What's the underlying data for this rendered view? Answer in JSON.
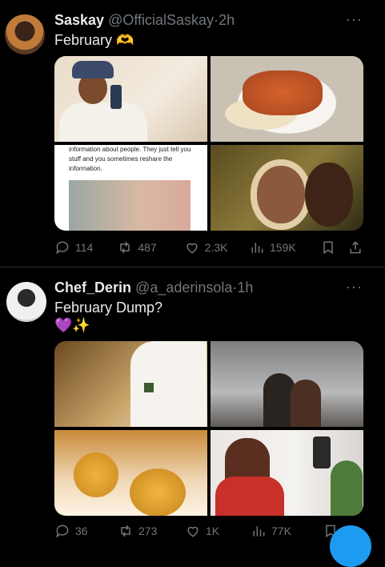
{
  "tweets": [
    {
      "name": "Saskay",
      "handle": "@OfficialSaskay",
      "time": "2h",
      "text": "February 🫶",
      "card_text": "information about people. They just tell you stuff and you sometimes reshare the information.",
      "stats": {
        "replies": "114",
        "retweets": "487",
        "likes": "2.3K",
        "views": "159K"
      }
    },
    {
      "name": "Chef_Derin",
      "handle": "@a_aderinsola",
      "time": "1h",
      "text": "February Dump?",
      "emoji_line": "💜✨",
      "stats": {
        "replies": "36",
        "retweets": "273",
        "likes": "1K",
        "views": "77K"
      }
    }
  ],
  "ui": {
    "more": "···",
    "dot": "·"
  },
  "icons": [
    "reply-icon",
    "retweet-icon",
    "like-icon",
    "views-icon",
    "bookmark-icon",
    "share-icon",
    "more-icon"
  ],
  "colors": {
    "background": "#000000",
    "text": "#e7e9ea",
    "muted": "#71767b",
    "accent": "#1d9bf0",
    "divider": "#2f3336"
  }
}
